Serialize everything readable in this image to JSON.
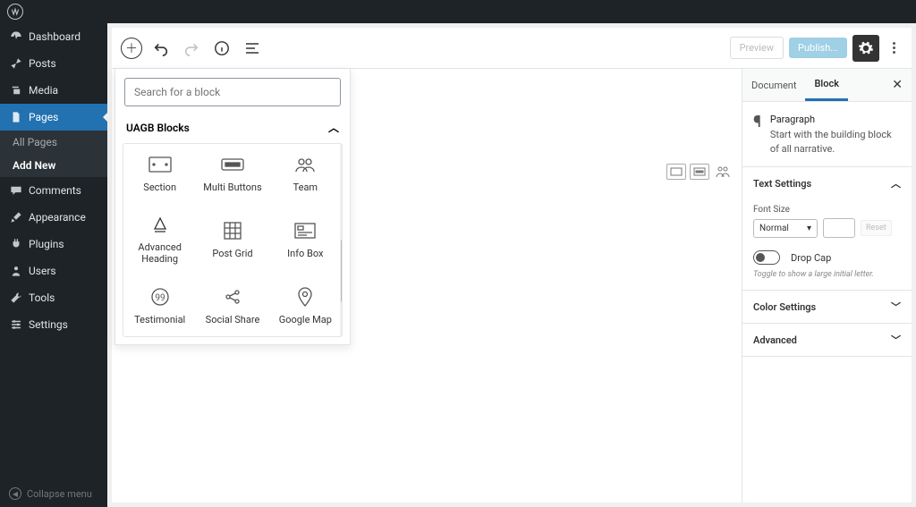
{
  "sidebar": {
    "items": [
      {
        "label": "Dashboard",
        "icon": "dashboard"
      },
      {
        "label": "Posts",
        "icon": "pin"
      },
      {
        "label": "Media",
        "icon": "media"
      },
      {
        "label": "Pages",
        "icon": "pages"
      },
      {
        "label": "Comments",
        "icon": "comment"
      },
      {
        "label": "Appearance",
        "icon": "brush"
      },
      {
        "label": "Plugins",
        "icon": "plug"
      },
      {
        "label": "Users",
        "icon": "user"
      },
      {
        "label": "Tools",
        "icon": "wrench"
      },
      {
        "label": "Settings",
        "icon": "sliders"
      }
    ],
    "subs": [
      {
        "label": "All Pages"
      },
      {
        "label": "Add New"
      }
    ],
    "collapse": "Collapse menu"
  },
  "toolbar": {
    "preview": "Preview",
    "publish": "Publish..."
  },
  "inserter": {
    "search_placeholder": "Search for a block",
    "category": "UAGB Blocks",
    "blocks": [
      {
        "label": "Section",
        "icon": "section"
      },
      {
        "label": "Multi Buttons",
        "icon": "buttons"
      },
      {
        "label": "Team",
        "icon": "team"
      },
      {
        "label": "Advanced Heading",
        "icon": "heading"
      },
      {
        "label": "Post Grid",
        "icon": "grid"
      },
      {
        "label": "Info Box",
        "icon": "infobox"
      },
      {
        "label": "Testimonial",
        "icon": "quote"
      },
      {
        "label": "Social Share",
        "icon": "share"
      },
      {
        "label": "Google Map",
        "icon": "map"
      }
    ]
  },
  "rside": {
    "tabs": {
      "document": "Document",
      "block": "Block"
    },
    "block_title": "Paragraph",
    "block_desc": "Start with the building block of all narrative.",
    "panel_text": "Text Settings",
    "font_size_label": "Font Size",
    "font_size_value": "Normal",
    "reset": "Reset",
    "drop_cap": "Drop Cap",
    "drop_cap_hint": "Toggle to show a large initial letter.",
    "panel_color": "Color Settings",
    "panel_advanced": "Advanced"
  }
}
